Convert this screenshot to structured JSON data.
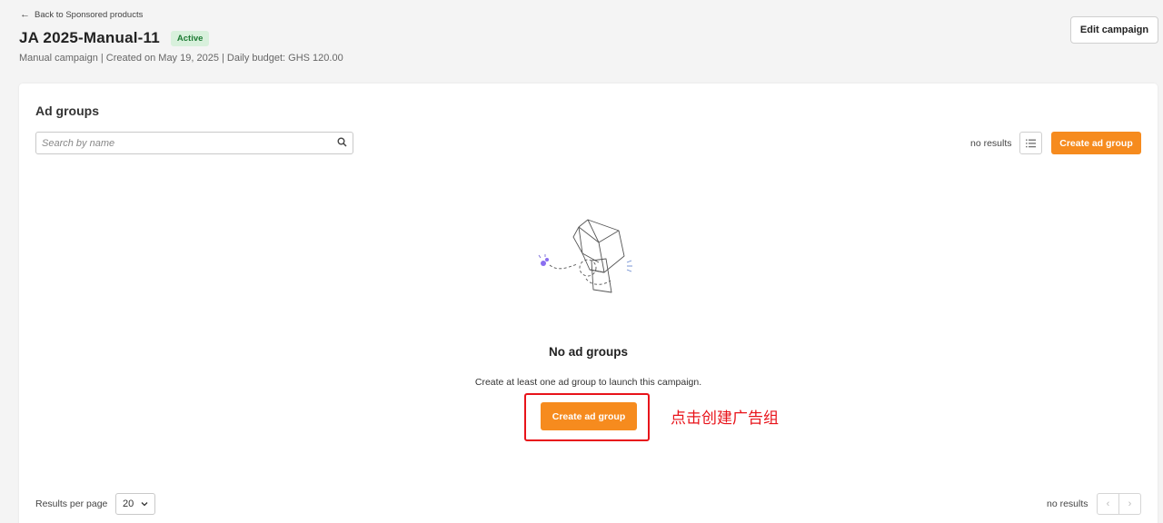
{
  "nav": {
    "back_label": "Back to Sponsored products"
  },
  "campaign": {
    "title": "JA 2025-Manual-11",
    "status": "Active",
    "meta": "Manual campaign | Created on May 19, 2025 | Daily budget: GHS 120.00"
  },
  "actions": {
    "edit_label": "Edit campaign"
  },
  "ad_groups": {
    "section_title": "Ad groups",
    "search_placeholder": "Search by name",
    "results_count_top": "no results",
    "create_label": "Create ad group"
  },
  "empty_state": {
    "title": "No ad groups",
    "description": "Create at least one ad group to launch this campaign.",
    "create_label": "Create ad group"
  },
  "annotation": {
    "text": "点击创建广告组",
    "color": "#e8131a"
  },
  "pagination": {
    "rpp_label": "Results per page",
    "rpp_value": "20",
    "results_count_bottom": "no results"
  },
  "colors": {
    "accent": "#f68b1e",
    "badge_bg": "#d8f0dc",
    "badge_text": "#1e7b34"
  }
}
